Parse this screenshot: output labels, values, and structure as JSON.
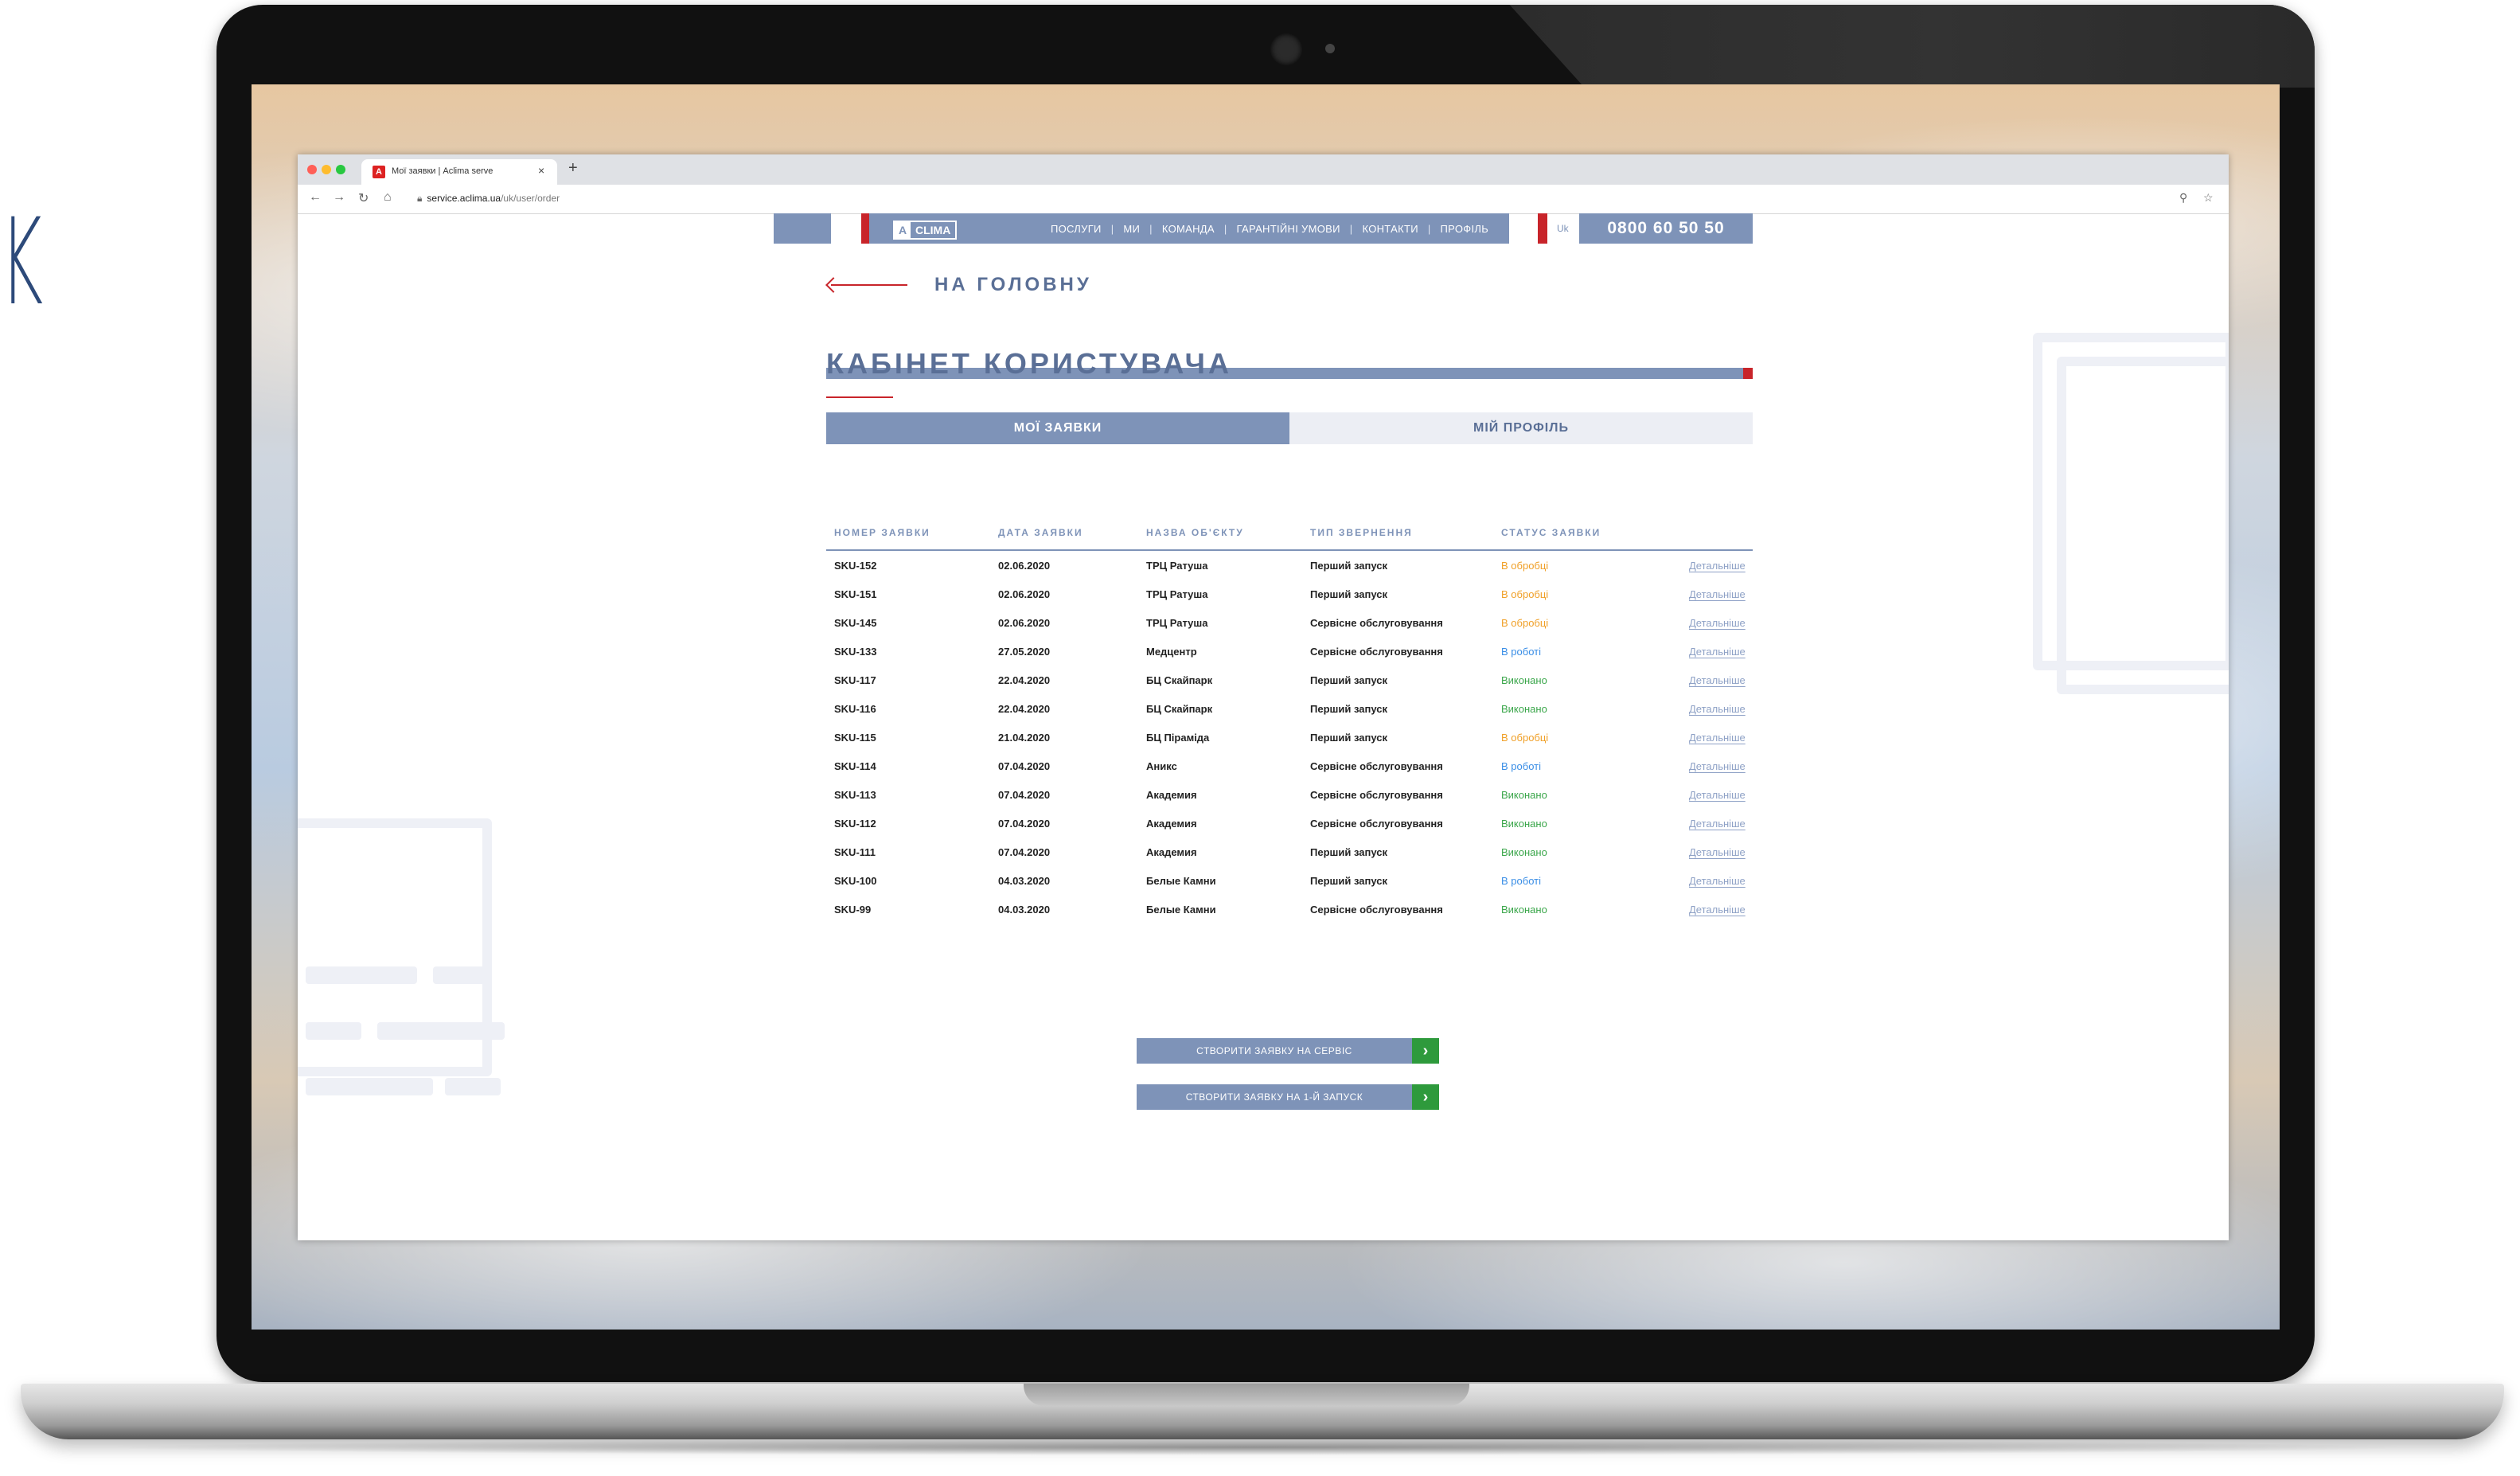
{
  "edge_letter": "K",
  "browser": {
    "tab_title": "Мої заявки | Aclima serve",
    "tab_favicon": "A",
    "new_tab": "+",
    "tab_close": "×",
    "url_host": "service.aclima.ua",
    "url_path": "/uk/user/order"
  },
  "header": {
    "logo_letter": "A",
    "logo_word": "CLIMA",
    "nav": [
      "ПОСЛУГИ",
      "МИ",
      "КОМАНДА",
      "ГАРАНТІЙНІ УМОВИ",
      "КОНТАКТИ",
      "ПРОФІЛЬ"
    ],
    "separator": "|",
    "lang": "Uk",
    "phone": "0800 60 50 50"
  },
  "back_link": "НА ГОЛОВНУ",
  "page_title": "КАБІНЕТ КОРИСТУВАЧА",
  "tabs": {
    "my_orders": "МОЇ ЗАЯВКИ",
    "my_profile": "МІЙ ПРОФІЛЬ"
  },
  "table": {
    "headers": [
      "НОМЕР ЗАЯВКИ",
      "ДАТА ЗАЯВКИ",
      "НАЗВА ОБ'ЄКТУ",
      "ТИП ЗВЕРНЕННЯ",
      "СТАТУС ЗАЯВКИ",
      ""
    ],
    "rows": [
      [
        "SKU-152",
        "02.06.2020",
        "ТРЦ Ратуша",
        "Перший запуск",
        "В обробці",
        "Детальніше"
      ],
      [
        "SKU-151",
        "02.06.2020",
        "ТРЦ Ратуша",
        "Перший запуск",
        "В обробці",
        "Детальніше"
      ],
      [
        "SKU-145",
        "02.06.2020",
        "ТРЦ Ратуша",
        "Сервісне обслуговування",
        "В обробці",
        "Детальніше"
      ],
      [
        "SKU-133",
        "27.05.2020",
        "Медцентр",
        "Сервісне обслуговування",
        "В роботі",
        "Детальніше"
      ],
      [
        "SKU-117",
        "22.04.2020",
        "БЦ Скайпарк",
        "Перший запуск",
        "Виконано",
        "Детальніше"
      ],
      [
        "SKU-116",
        "22.04.2020",
        "БЦ Скайпарк",
        "Перший запуск",
        "Виконано",
        "Детальніше"
      ],
      [
        "SKU-115",
        "21.04.2020",
        "БЦ Піраміда",
        "Перший запуск",
        "В обробці",
        "Детальніше"
      ],
      [
        "SKU-114",
        "07.04.2020",
        "Аникс",
        "Сервісне обслуговування",
        "В роботі",
        "Детальніше"
      ],
      [
        "SKU-113",
        "07.04.2020",
        "Академия",
        "Сервісне обслуговування",
        "Виконано",
        "Детальніше"
      ],
      [
        "SKU-112",
        "07.04.2020",
        "Академия",
        "Сервісне обслуговування",
        "Виконано",
        "Детальніше"
      ],
      [
        "SKU-111",
        "07.04.2020",
        "Академия",
        "Перший запуск",
        "Виконано",
        "Детальніше"
      ],
      [
        "SKU-100",
        "04.03.2020",
        "Белые Камни",
        "Перший запуск",
        "В роботі",
        "Детальніше"
      ],
      [
        "SKU-99",
        "04.03.2020",
        "Белые Камни",
        "Сервісне обслуговування",
        "Виконано",
        "Детальніше"
      ]
    ],
    "status_colors": {
      "В обробці": "#f0a028",
      "В роботі": "#3a8ee6",
      "Виконано": "#3aa64a"
    }
  },
  "actions": {
    "create_service": "СТВОРИТИ ЗАЯВКУ НА СЕРВІС",
    "create_first_start": "СТВОРИТИ ЗАЯВКУ НА 1-Й ЗАПУСК",
    "arrow": "›"
  },
  "colors": {
    "accent": "#7e93b8",
    "red": "#c8242a",
    "green": "#2e9a3c"
  }
}
